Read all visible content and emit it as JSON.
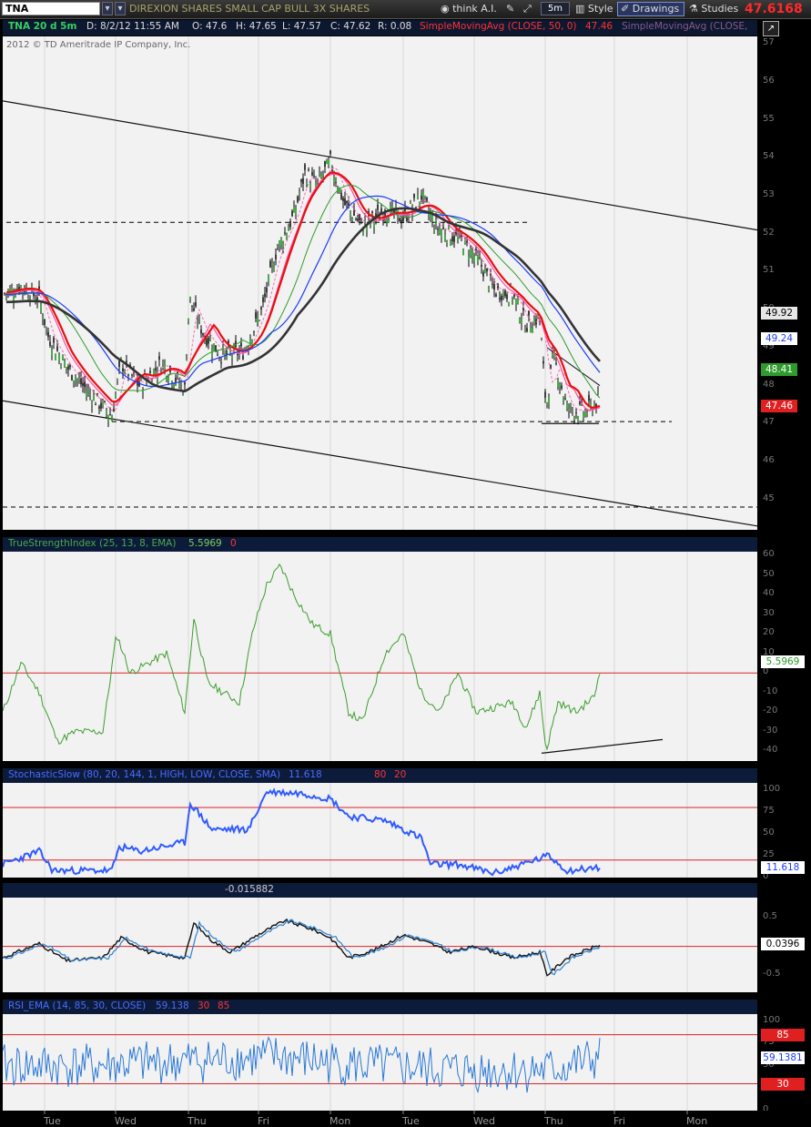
{
  "toolbar": {
    "symbol": "TNA",
    "description": "DIREXION SHARES SMALL CAP BULL 3X SHARES",
    "think_ai": "think A.I.",
    "timeframe": "5m",
    "style": "Style",
    "drawings": "Drawings",
    "studies": "Studies",
    "last_price": "47.6168"
  },
  "price_header": {
    "label": "TNA 20 d 5m",
    "date": "D: 8/2/12 11:55 AM",
    "open": "O: 47.6",
    "high": "H: 47.65",
    "low": "L: 47.57",
    "close": "C: 47.62",
    "range": "R: 0.08",
    "sma1": "SimpleMovingAvg (CLOSE, 50, 0)",
    "sma1_value": "47.46",
    "sma2": "SimpleMovingAvg (CLOSE,",
    "copyright": "2012 © TD Ameritrade IP Company, Inc."
  },
  "price_axis": {
    "ticks": [
      "57",
      "56",
      "55",
      "54",
      "53",
      "52",
      "51",
      "50",
      "49",
      "48",
      "47",
      "46",
      "45"
    ],
    "tags": [
      {
        "value": "49.92",
        "bg": "#e6e6e6",
        "fg": "#000"
      },
      {
        "value": "49.24",
        "bg": "#ffffff",
        "fg": "#1a3cff"
      },
      {
        "value": "48.41",
        "bg": "#2f9b2f",
        "fg": "#ffffff"
      },
      {
        "value": "47.46",
        "bg": "#e02020",
        "fg": "#ffffff"
      }
    ]
  },
  "tsi": {
    "title": "TrueStrengthIndex (25, 13, 8, EMA)",
    "value": "5.5969",
    "zero": "0",
    "ticks": [
      "60",
      "50",
      "40",
      "30",
      "20",
      "10",
      "0",
      "-10",
      "-20",
      "-30",
      "-40"
    ],
    "tag": "5.5969"
  },
  "stoch": {
    "title": "StochasticSlow (80, 20, 144, 1, HIGH, LOW, CLOSE, SMA)",
    "value": "11.618",
    "ob": "80",
    "os": "20",
    "ticks": [
      "100",
      "75",
      "50",
      "25",
      "0"
    ],
    "tag": "11.618"
  },
  "osc": {
    "value": "-0.015882",
    "ticks": [
      "0.5",
      "0",
      "-0.5"
    ],
    "tag": "0.0396"
  },
  "rsi": {
    "title": "RSI_EMA (14, 85, 30, CLOSE)",
    "value": "59.138",
    "lo": "30",
    "hi": "85",
    "ticks": [
      "100",
      "75",
      "50",
      "25",
      "0"
    ],
    "tag_hi": "85",
    "tag_val": "59.1381",
    "tag_lo": "30"
  },
  "x_axis": [
    "Tue",
    "Wed",
    "Thu",
    "Fri",
    "Mon",
    "Tue",
    "Wed",
    "Thu",
    "Fri",
    "Mon"
  ],
  "chart_data": {
    "type": "line",
    "symbol": "TNA",
    "price_range": [
      44.2,
      57.2
    ],
    "sessions": [
      "Tue",
      "Wed",
      "Thu",
      "Fri",
      "Mon",
      "Tue",
      "Wed",
      "Thu",
      "Fri",
      "Mon"
    ],
    "price_close_by_session": [
      {
        "x": "Tue",
        "v": 50.4
      },
      {
        "x": "Tue",
        "v": 48.8
      },
      {
        "x": "Wed",
        "v": 47.2
      },
      {
        "x": "Wed",
        "v": 48.3
      },
      {
        "x": "Thu",
        "v": 48.0
      },
      {
        "x": "Thu",
        "v": 49.8
      },
      {
        "x": "Thu",
        "v": 49.0
      },
      {
        "x": "Fri",
        "v": 49.0
      },
      {
        "x": "Fri",
        "v": 51.5
      },
      {
        "x": "Fri",
        "v": 52.8
      },
      {
        "x": "Mon",
        "v": 53.8
      },
      {
        "x": "Mon",
        "v": 52.3
      },
      {
        "x": "Tue",
        "v": 52.8
      },
      {
        "x": "Tue",
        "v": 52.3
      },
      {
        "x": "Wed",
        "v": 51.2
      },
      {
        "x": "Wed",
        "v": 50.2
      },
      {
        "x": "Thu",
        "v": 47.2
      },
      {
        "x": "Thu",
        "v": 47.6
      }
    ],
    "sma_latest": {
      "sma50": 47.46,
      "sma_green": 48.41,
      "sma_blue": 49.24,
      "sma_black": 49.92
    },
    "tsi_range": [
      -45,
      62
    ],
    "tsi_last": 5.5969,
    "stoch_last": 11.618,
    "osc_last": 0.0396,
    "rsi_last": 59.1381
  }
}
